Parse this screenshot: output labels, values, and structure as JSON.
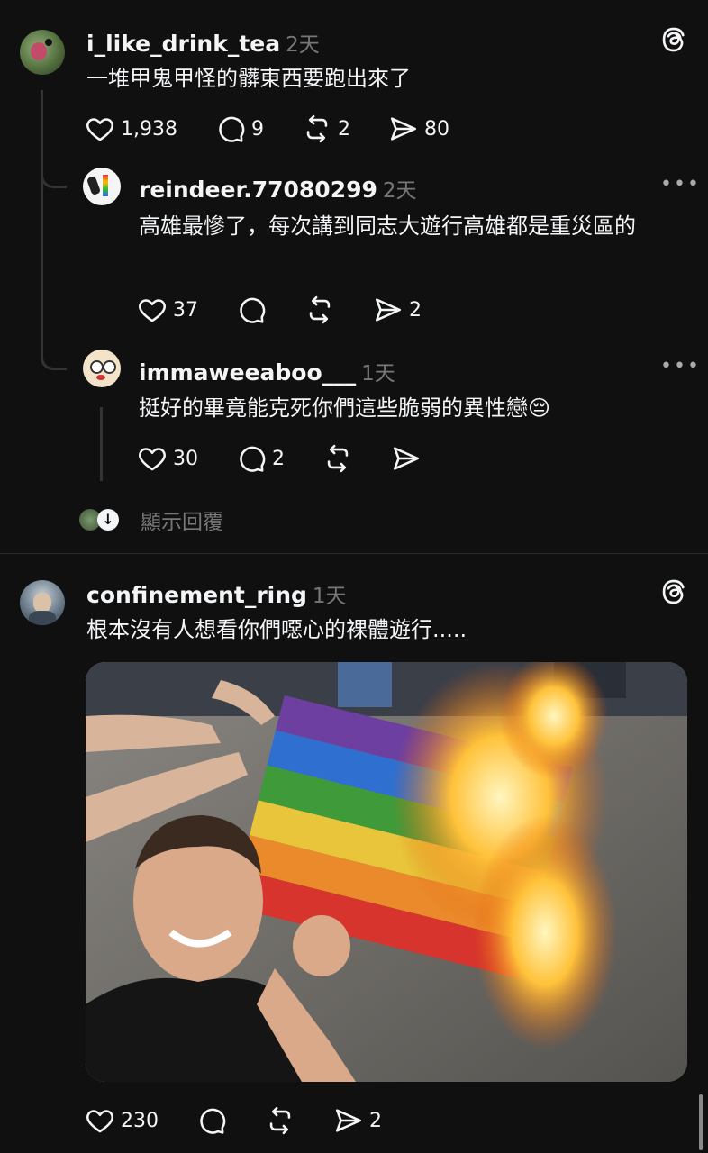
{
  "post1": {
    "username": "i_like_drink_tea",
    "time": "2天",
    "text": "一堆甲鬼甲怪的髒東西要跑出來了",
    "likes": "1,938",
    "comments": "9",
    "reposts": "2",
    "shares": "80"
  },
  "reply1": {
    "username": "reindeer.77080299",
    "time": "2天",
    "text": "高雄最慘了，每次講到同志大遊行高雄都是重災區的",
    "likes": "37",
    "shares": "2"
  },
  "reply2": {
    "username": "immaweeaboo___",
    "time": "1天",
    "text": "挺好的畢竟能克死你們這些脆弱的異性戀",
    "emoji": "😔",
    "likes": "30",
    "comments": "2"
  },
  "show_replies": "顯示回覆",
  "post2": {
    "username": "confinement_ring",
    "time": "1天",
    "text": "根本沒有人想看你們噁心的裸體遊行.....",
    "likes": "230",
    "shares": "2"
  },
  "icons": {
    "threads_logo": "threads-logo-icon",
    "like": "heart-icon",
    "comment": "comment-bubble-icon",
    "repost": "repost-icon",
    "share": "send-icon",
    "more": "more-options-icon"
  },
  "colors": {
    "background": "#101010",
    "text": "#f3f5f7",
    "muted": "#777777"
  }
}
